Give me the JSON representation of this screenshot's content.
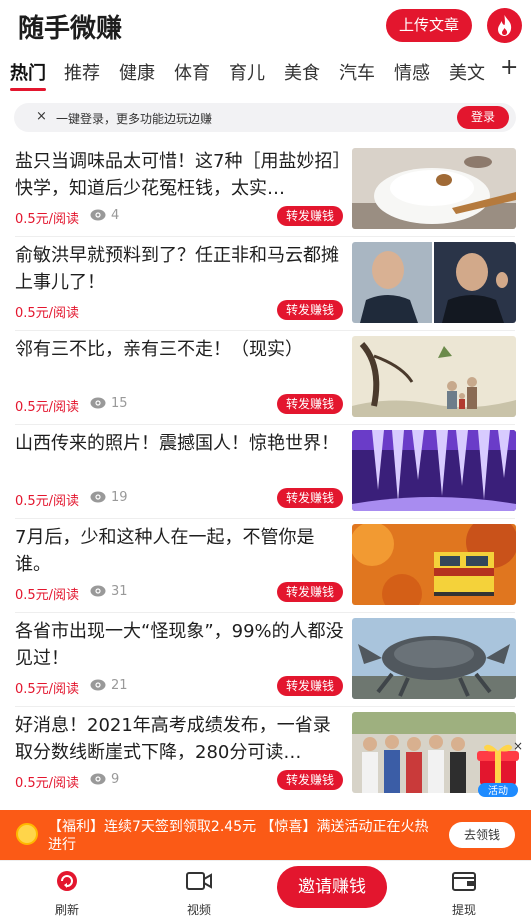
{
  "header": {
    "title": "随手微赚",
    "upload_label": "上传文章",
    "fire_icon": "fire-icon"
  },
  "tabs": [
    {
      "label": "热门",
      "active": true
    },
    {
      "label": "推荐"
    },
    {
      "label": "健康"
    },
    {
      "label": "体育"
    },
    {
      "label": "育儿"
    },
    {
      "label": "美食"
    },
    {
      "label": "汽车"
    },
    {
      "label": "情感"
    },
    {
      "label": "美文"
    }
  ],
  "tab_add_icon": "+",
  "login_bar": {
    "close_icon": "×",
    "text": "一键登录，更多功能边玩边赚",
    "button": "登录"
  },
  "feed": [
    {
      "title": "盐只当调味品太可惜！这7种［用盐妙招］快学，知道后少花冤枉钱，太实…",
      "price": "0.5元/阅读",
      "views": "4",
      "share": "转发赚钱"
    },
    {
      "title": "俞敏洪早就预料到了？任正非和马云都摊上事儿了！",
      "price": "0.5元/阅读",
      "views": "",
      "share": "转发赚钱"
    },
    {
      "title": "邻有三不比，亲有三不走！（现实）",
      "price": "0.5元/阅读",
      "views": "15",
      "share": "转发赚钱"
    },
    {
      "title": "山西传来的照片！震撼国人！惊艳世界！",
      "price": "0.5元/阅读",
      "views": "19",
      "share": "转发赚钱"
    },
    {
      "title": "7月后，少和这种人在一起，不管你是谁。",
      "price": "0.5元/阅读",
      "views": "31",
      "share": "转发赚钱"
    },
    {
      "title": "各省市出现一大“怪现象”，99%的人都没见过！",
      "price": "0.5元/阅读",
      "views": "21",
      "share": "转发赚钱"
    },
    {
      "title": "好消息！2021年高考成绩发布，一省录取分数线断崖式下降，280分可读…",
      "price": "0.5元/阅读",
      "views": "9",
      "share": "转发赚钱"
    }
  ],
  "activity": {
    "label": "活动",
    "close": "×"
  },
  "banner": {
    "text": "【福利】连续7天签到领取2.45元 【惊喜】满送活动正在火热进行",
    "button": "去领钱"
  },
  "bottom_nav": {
    "refresh": "刷新",
    "video": "视频",
    "invite": "邀请赚钱",
    "withdraw": "提现"
  },
  "colors": {
    "accent": "#e3162e",
    "banner": "#fb5a16"
  }
}
